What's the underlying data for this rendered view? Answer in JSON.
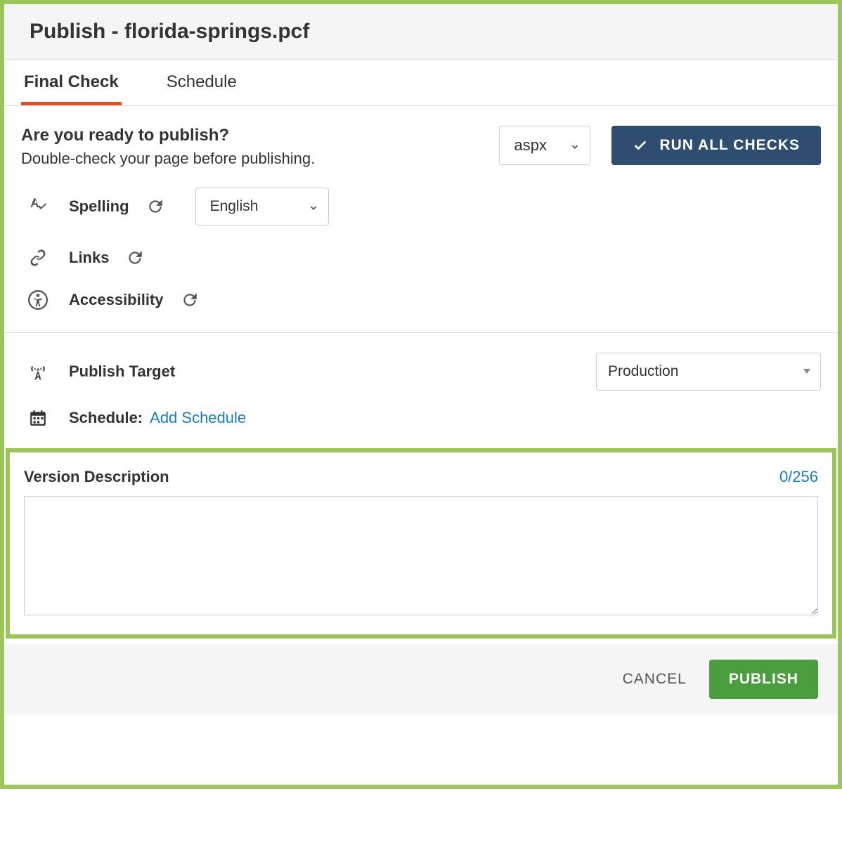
{
  "header": {
    "title": "Publish - florida-springs.pcf"
  },
  "tabs": [
    {
      "label": "Final Check",
      "active": true
    },
    {
      "label": "Schedule",
      "active": false
    }
  ],
  "ready": {
    "heading": "Are you ready to publish?",
    "subtext": "Double-check your page before publishing."
  },
  "extSelect": {
    "value": "aspx"
  },
  "runButton": {
    "label": "RUN ALL CHECKS"
  },
  "checks": {
    "spelling": {
      "label": "Spelling",
      "language": "English"
    },
    "links": {
      "label": "Links"
    },
    "accessibility": {
      "label": "Accessibility"
    }
  },
  "publishTarget": {
    "label": "Publish Target",
    "value": "Production"
  },
  "schedule": {
    "label": "Schedule:",
    "link": "Add Schedule"
  },
  "versionDesc": {
    "label": "Version Description",
    "count": "0/256",
    "value": ""
  },
  "footer": {
    "cancel": "CANCEL",
    "publish": "PUBLISH"
  }
}
